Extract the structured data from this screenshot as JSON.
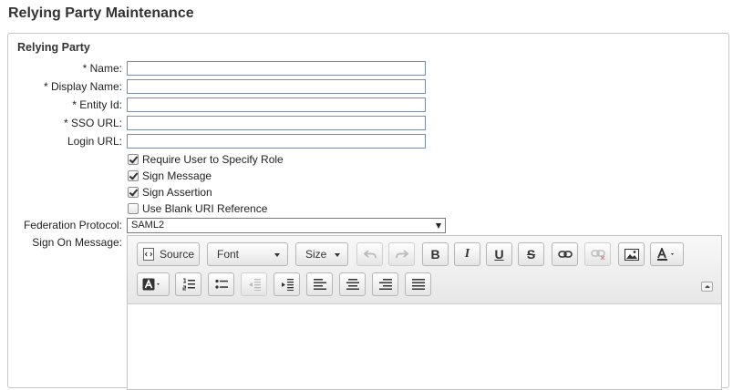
{
  "page": {
    "title": "Relying Party Maintenance"
  },
  "panel": {
    "title": "Relying Party"
  },
  "fields": {
    "name": {
      "label": "* Name:",
      "value": ""
    },
    "display_name": {
      "label": "* Display Name:",
      "value": ""
    },
    "entity_id": {
      "label": "* Entity Id:",
      "value": ""
    },
    "sso_url": {
      "label": "* SSO URL:",
      "value": ""
    },
    "login_url": {
      "label": "Login URL:",
      "value": ""
    }
  },
  "checkboxes": [
    {
      "label": "Require User to Specify Role",
      "checked": true
    },
    {
      "label": "Sign Message",
      "checked": true
    },
    {
      "label": "Sign Assertion",
      "checked": true
    },
    {
      "label": "Use Blank URI Reference",
      "checked": false
    }
  ],
  "federation_protocol": {
    "label": "Federation Protocol:",
    "selected": "SAML2"
  },
  "sign_on_message": {
    "label": "Sign On Message:"
  },
  "editor": {
    "source_label": "Source",
    "font_label": "Font",
    "size_label": "Size",
    "bold_glyph": "B",
    "italic_glyph": "I",
    "underline_glyph": "U",
    "strike_glyph": "S"
  },
  "icons": [
    "source-icon",
    "undo-icon",
    "redo-icon",
    "link-icon",
    "unlink-icon",
    "image-icon",
    "text-color-icon",
    "background-color-icon",
    "numbered-list-icon",
    "bulleted-list-icon",
    "outdent-icon",
    "indent-icon",
    "align-left-icon",
    "align-center-icon",
    "align-right-icon",
    "justify-icon",
    "collapse-toolbar-icon"
  ]
}
